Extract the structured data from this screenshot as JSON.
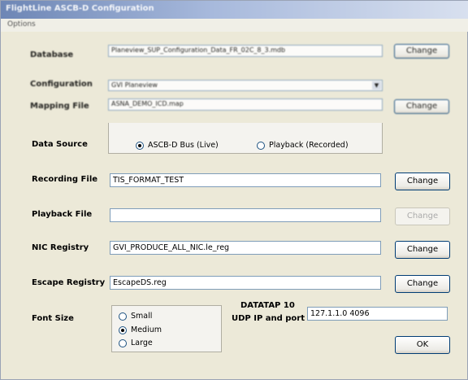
{
  "window": {
    "title": "FlightLine ASCB-D Configuration"
  },
  "menu": {
    "options_label": "Options"
  },
  "database": {
    "label": "Database",
    "value": "Planeview_SUP_Configuration_Data_FR_02C_8_3.mdb",
    "button": "Change"
  },
  "configuration": {
    "label": "Configuration",
    "value": "GVI Planeview"
  },
  "mapping_file": {
    "label": "Mapping File",
    "value": "ASNA_DEMO_ICD.map",
    "button": "Change"
  },
  "data_source": {
    "label": "Data Source",
    "options": [
      {
        "label": "ASCB-D Bus (Live)",
        "selected": true
      },
      {
        "label": "Playback (Recorded)",
        "selected": false
      }
    ]
  },
  "recording_file": {
    "label": "Recording File",
    "value": "TIS_FORMAT_TEST",
    "button": "Change"
  },
  "playback_file": {
    "label": "Playback File",
    "value": "",
    "button": "Change",
    "button_enabled": false
  },
  "nic_registry": {
    "label": "NIC Registry",
    "value": "GVI_PRODUCE_ALL_NIC.le_reg",
    "button": "Change"
  },
  "escape_registry": {
    "label": "Escape Registry",
    "value": "EscapeDS.reg",
    "button": "Change"
  },
  "font_size": {
    "label": "Font Size",
    "options": [
      {
        "label": "Small",
        "selected": false
      },
      {
        "label": "Medium",
        "selected": true
      },
      {
        "label": "Large",
        "selected": false
      }
    ]
  },
  "datatap": {
    "title": "DATATAP 10",
    "subtitle": "UDP IP and port",
    "value": "127.1.1.0 4096"
  },
  "ok_button": "OK"
}
